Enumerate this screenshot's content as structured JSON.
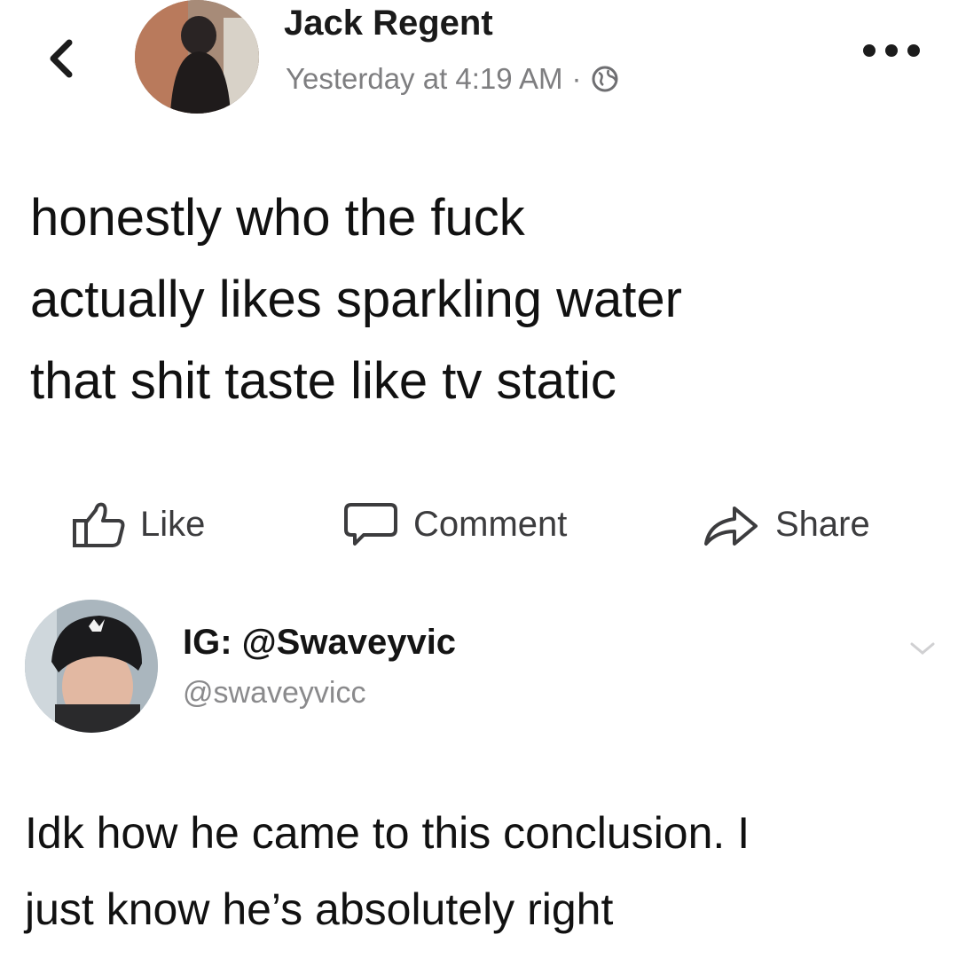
{
  "facebook_post": {
    "author_name": "Jack Regent",
    "timestamp": "Yesterday at 4:19 AM",
    "separator": "·",
    "audience_icon": "globe-icon",
    "back_icon": "chevron-left-icon",
    "more_icon": "more-horizontal-icon",
    "body_lines": [
      "honestly who the fuck",
      "actually likes sparkling water",
      "that shit taste like tv static"
    ],
    "actions": {
      "like_label": "Like",
      "comment_label": "Comment",
      "share_label": "Share"
    }
  },
  "tweet": {
    "display_name": "IG: @Swaveyvic",
    "handle": "@swaveyvicc",
    "chevron_icon": "chevron-down-icon",
    "body_lines": [
      "Idk how he came to this conclusion. I",
      "just know he’s absolutely right"
    ]
  },
  "colors": {
    "text_primary": "#111111",
    "text_secondary": "#7e7e80",
    "background": "#ffffff"
  }
}
